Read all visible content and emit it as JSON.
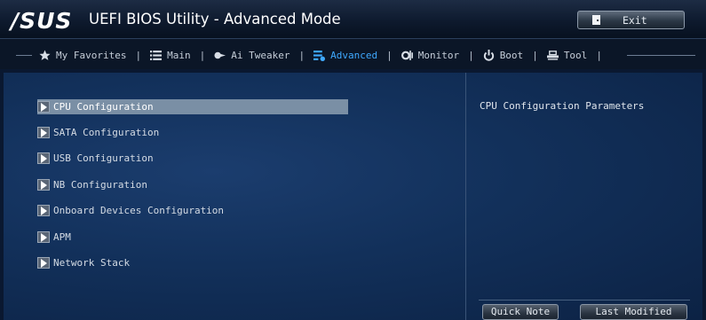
{
  "header": {
    "logo": "/SUS",
    "title": "UEFI BIOS Utility - Advanced Mode",
    "exit_label": "Exit"
  },
  "tabs": [
    {
      "label": "My Favorites",
      "icon": "star-icon",
      "active": false
    },
    {
      "label": "Main",
      "icon": "list-icon",
      "active": false
    },
    {
      "label": "Ai Tweaker",
      "icon": "ai-tweaker-icon",
      "active": false
    },
    {
      "label": "Advanced",
      "icon": "advanced-icon",
      "active": true
    },
    {
      "label": "Monitor",
      "icon": "monitor-icon",
      "active": false
    },
    {
      "label": "Boot",
      "icon": "power-icon",
      "active": false
    },
    {
      "label": "Tool",
      "icon": "tool-icon",
      "active": false
    }
  ],
  "menu": [
    {
      "label": "CPU Configuration",
      "selected": true
    },
    {
      "label": "SATA Configuration",
      "selected": false
    },
    {
      "label": "USB Configuration",
      "selected": false
    },
    {
      "label": "NB Configuration",
      "selected": false
    },
    {
      "label": "Onboard Devices Configuration",
      "selected": false
    },
    {
      "label": "APM",
      "selected": false
    },
    {
      "label": "Network Stack",
      "selected": false
    }
  ],
  "help": {
    "text": "CPU Configuration Parameters"
  },
  "footer": {
    "quick_note_label": "Quick Note",
    "last_modified_label": "Last Modified"
  },
  "colors": {
    "accent": "#3fa9ff",
    "selection": "#7a8fa5",
    "background": "#12305a"
  }
}
